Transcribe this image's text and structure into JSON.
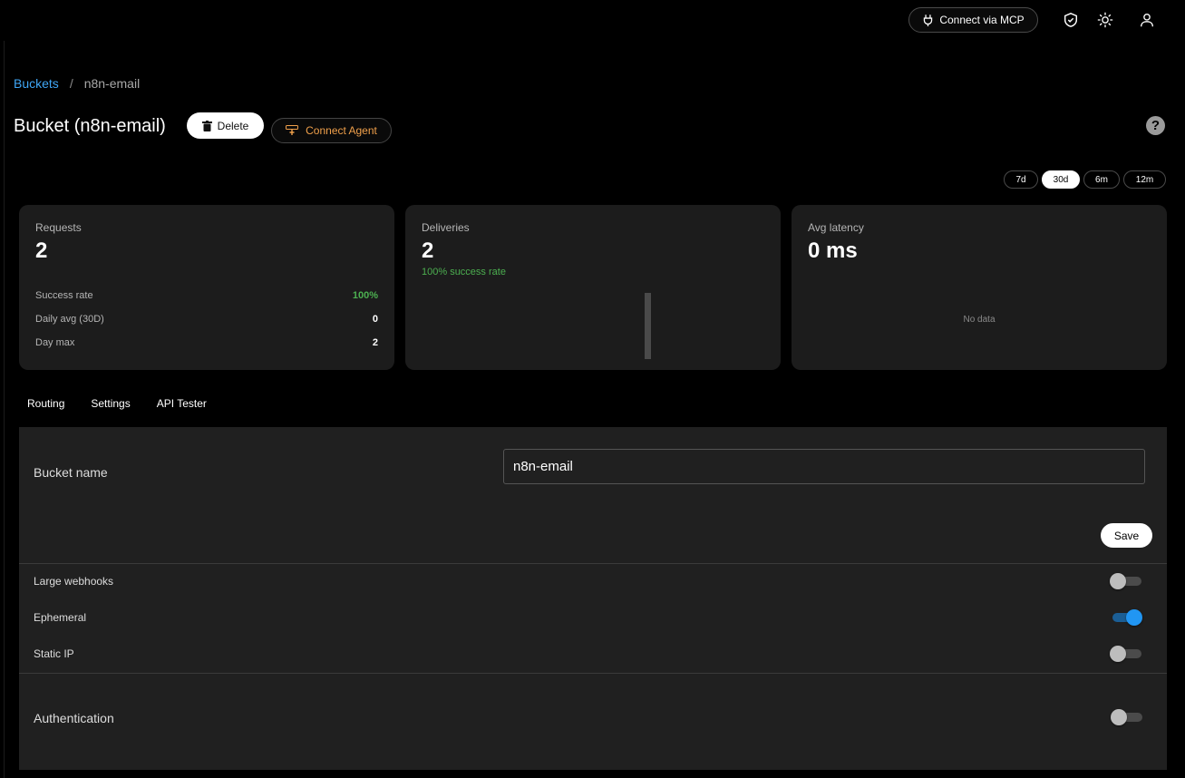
{
  "header": {
    "mcp_label": "Connect via MCP"
  },
  "breadcrumb": {
    "root": "Buckets",
    "separator": "/",
    "current": "n8n-email"
  },
  "page": {
    "title": "Bucket (n8n-email)",
    "delete_label": "Delete",
    "connect_agent_label": "Connect Agent",
    "help": "?"
  },
  "ranges": {
    "options": [
      "7d",
      "30d",
      "6m",
      "12m"
    ],
    "selected": "30d"
  },
  "cards": {
    "requests": {
      "label": "Requests",
      "value": "2",
      "rows": [
        {
          "label": "Success rate",
          "value": "100%"
        },
        {
          "label": "Daily avg (30D)",
          "value": "0"
        },
        {
          "label": "Day max",
          "value": "2"
        }
      ]
    },
    "deliveries": {
      "label": "Deliveries",
      "value": "2",
      "note": "100% success rate"
    },
    "latency": {
      "label": "Avg latency",
      "value": "0 ms",
      "empty": "No data"
    }
  },
  "tabs": [
    "Routing",
    "Settings",
    "API Tester"
  ],
  "settings": {
    "bucket_name_label": "Bucket name",
    "bucket_name_value": "n8n-email",
    "save_label": "Save",
    "toggles": [
      {
        "label": "Large webhooks",
        "on": false
      },
      {
        "label": "Ephemeral",
        "on": true
      },
      {
        "label": "Static IP",
        "on": false
      }
    ],
    "auth_label": "Authentication",
    "auth_on": false
  },
  "colors": {
    "link": "#3fa6f5",
    "success": "#4caf50",
    "accent_orange": "#f0a04b",
    "toggle_on": "#2196f3"
  }
}
